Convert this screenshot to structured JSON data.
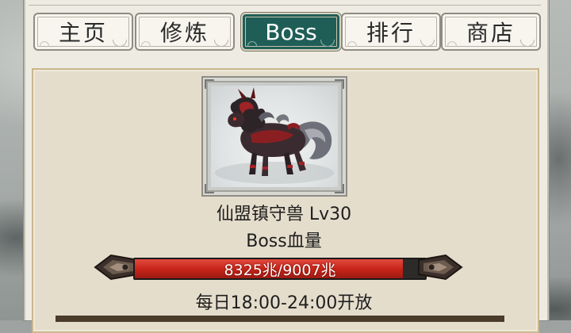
{
  "tabs": [
    {
      "label": "主页",
      "active": false
    },
    {
      "label": "修炼",
      "active": false
    },
    {
      "label": "Boss",
      "active": true
    },
    {
      "label": "排行",
      "active": false
    },
    {
      "label": "商店",
      "active": false
    }
  ],
  "boss": {
    "name": "仙盟镇守兽 Lv30",
    "section_label": "Boss血量",
    "hp_text": "8325兆/9007兆",
    "hp_fraction": 0.924,
    "open_time": "每日18:00-24:00开放"
  },
  "colors": {
    "active_tab": "#1f5e57",
    "hp_fill": "#c92519"
  }
}
